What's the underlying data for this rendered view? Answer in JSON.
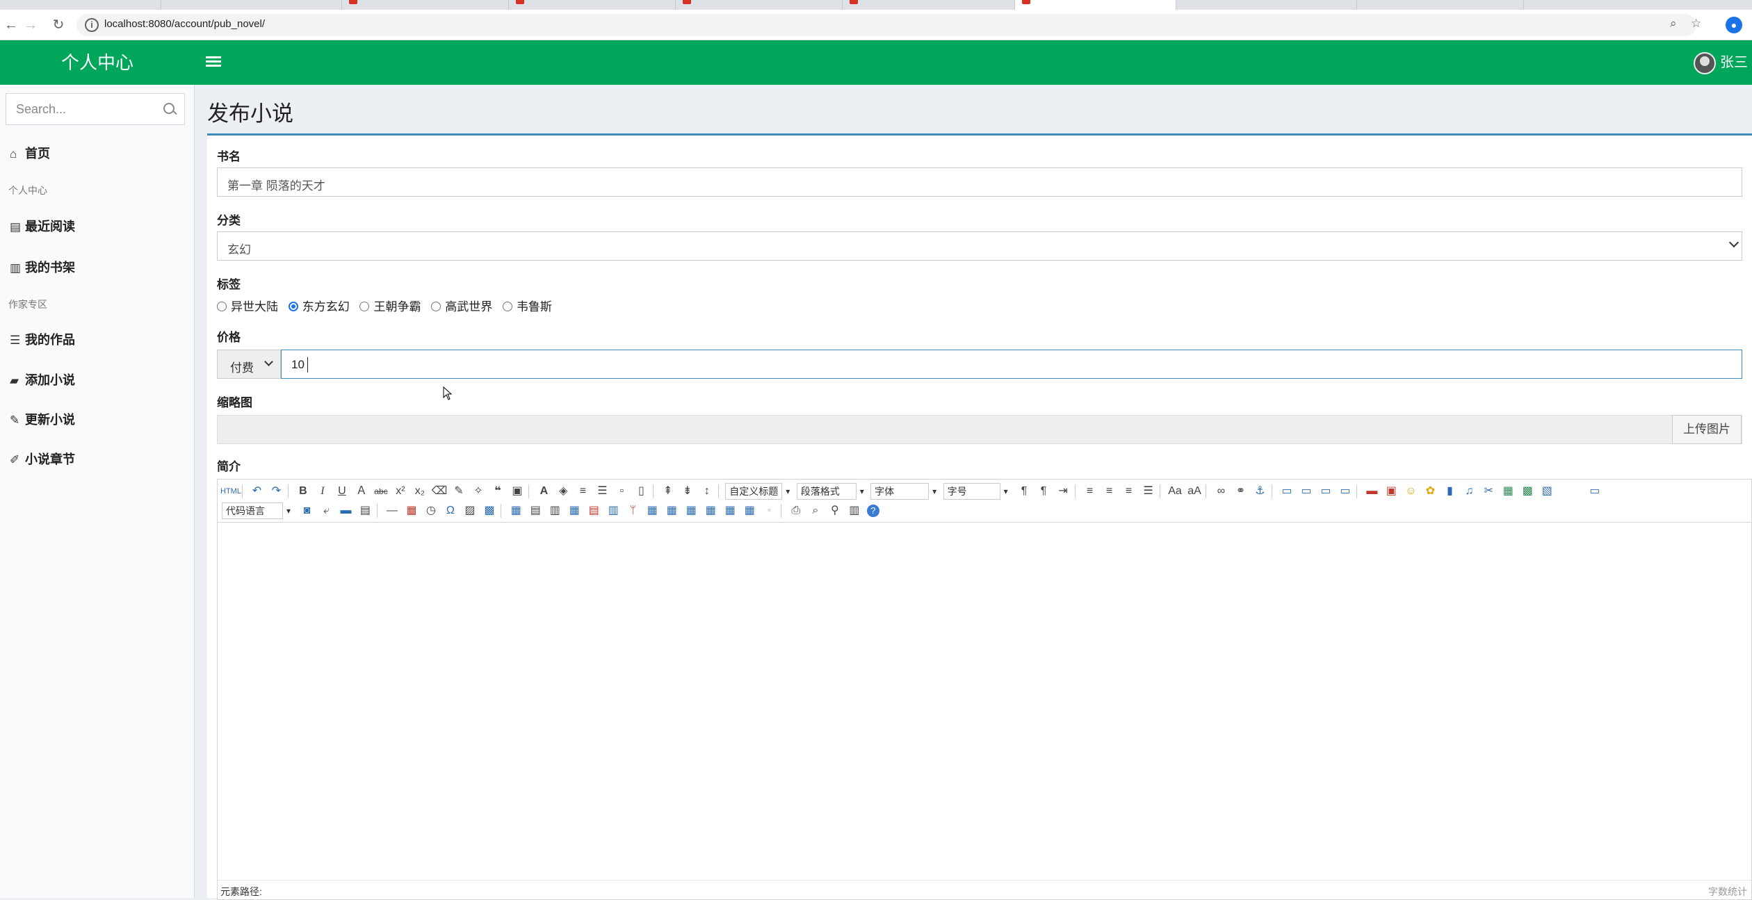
{
  "browser": {
    "url": "localhost:8080/account/pub_novel/"
  },
  "header": {
    "logo": "个人中心",
    "username": "张三"
  },
  "sidebar": {
    "search_placeholder": "Search...",
    "items": [
      {
        "label": "首页",
        "icon": "home-icon"
      },
      {
        "label": "个人中心",
        "type": "header"
      },
      {
        "label": "最近阅读",
        "icon": "columns-icon"
      },
      {
        "label": "我的书架",
        "icon": "book-icon"
      },
      {
        "label": "作家专区",
        "type": "header"
      },
      {
        "label": "我的作品",
        "icon": "list-icon"
      },
      {
        "label": "添加小说",
        "icon": "shopping-bag-icon"
      },
      {
        "label": "更新小说",
        "icon": "pen-icon"
      },
      {
        "label": "小说章节",
        "icon": "edit-icon"
      }
    ]
  },
  "page": {
    "title": "发布小说"
  },
  "form": {
    "name_label": "书名",
    "name_value": "第一章 陨落的天才",
    "category_label": "分类",
    "category_value": "玄幻",
    "tags_label": "标签",
    "tags": [
      {
        "label": "异世大陆",
        "checked": false
      },
      {
        "label": "东方玄幻",
        "checked": true
      },
      {
        "label": "王朝争霸",
        "checked": false
      },
      {
        "label": "高武世界",
        "checked": false
      },
      {
        "label": "韦鲁斯",
        "checked": false
      }
    ],
    "price_label": "价格",
    "price_type": "付费",
    "price_value": "10",
    "thumb_label": "缩略图",
    "upload_button": "上传图片",
    "intro_label": "简介"
  },
  "editor": {
    "combo_custom_title": "自定义标题",
    "combo_paragraph": "段落格式",
    "combo_font": "字体",
    "combo_size": "字号",
    "combo_code": "代码语言",
    "element_path": "元素路径:",
    "word_count": "字数统计"
  },
  "colors": {
    "header_bg": "#00a65a",
    "box_border": "#3c8dbc",
    "content_bg": "#ecf0f5"
  }
}
